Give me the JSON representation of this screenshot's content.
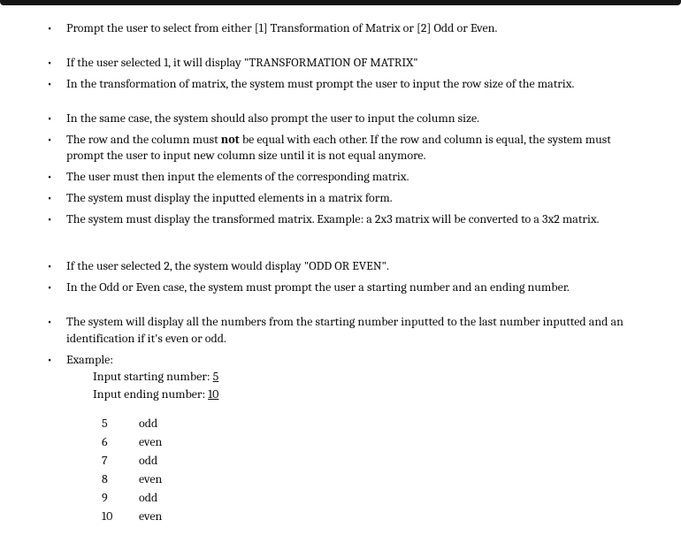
{
  "bullets": {
    "b1": "Prompt the user to select from either [1] Transformation of Matrix or [2] Odd or Even.",
    "b2": "If the user selected 1, it will display \"TRANSFORMATION OF MATRIX\" ",
    "b3": "In the transformation of matrix, the system must prompt the user to input the row size of the matrix.",
    "b4": "In the same case, the system should also prompt the user to input the column size.",
    "b5a": "The row and the column must ",
    "b5_bold": "not",
    "b5b": " be equal with each other. If the row and column is equal, the system must prompt the user to input new column size until it is not equal anymore.",
    "b6": "The user must then input the elements of the corresponding matrix.",
    "b7": "The system must display the inputted elements in a matrix form.",
    "b8": "The system must display the transformed matrix. Example: a 2x3 matrix will be converted to a 3x2 matrix.",
    "b9": "If the user selected 2, the system would display \"ODD OR EVEN\".",
    "b10": "In the Odd or Even case, the system must prompt the user a starting number and an ending number.",
    "b11": "The system will display all the numbers from the starting number inputted to the last number inputted and an identification if it's even or odd.",
    "b12": "Example:",
    "inputs": {
      "start_label": "Input starting number: ",
      "start_val": "5",
      "end_label": "Input ending number: ",
      "end_val": "10"
    }
  },
  "table": [
    {
      "n": "5",
      "p": "odd"
    },
    {
      "n": "6",
      "p": "even"
    },
    {
      "n": "7",
      "p": "odd"
    },
    {
      "n": "8",
      "p": "even"
    },
    {
      "n": "9",
      "p": "odd"
    },
    {
      "n": "10",
      "p": "even"
    }
  ]
}
